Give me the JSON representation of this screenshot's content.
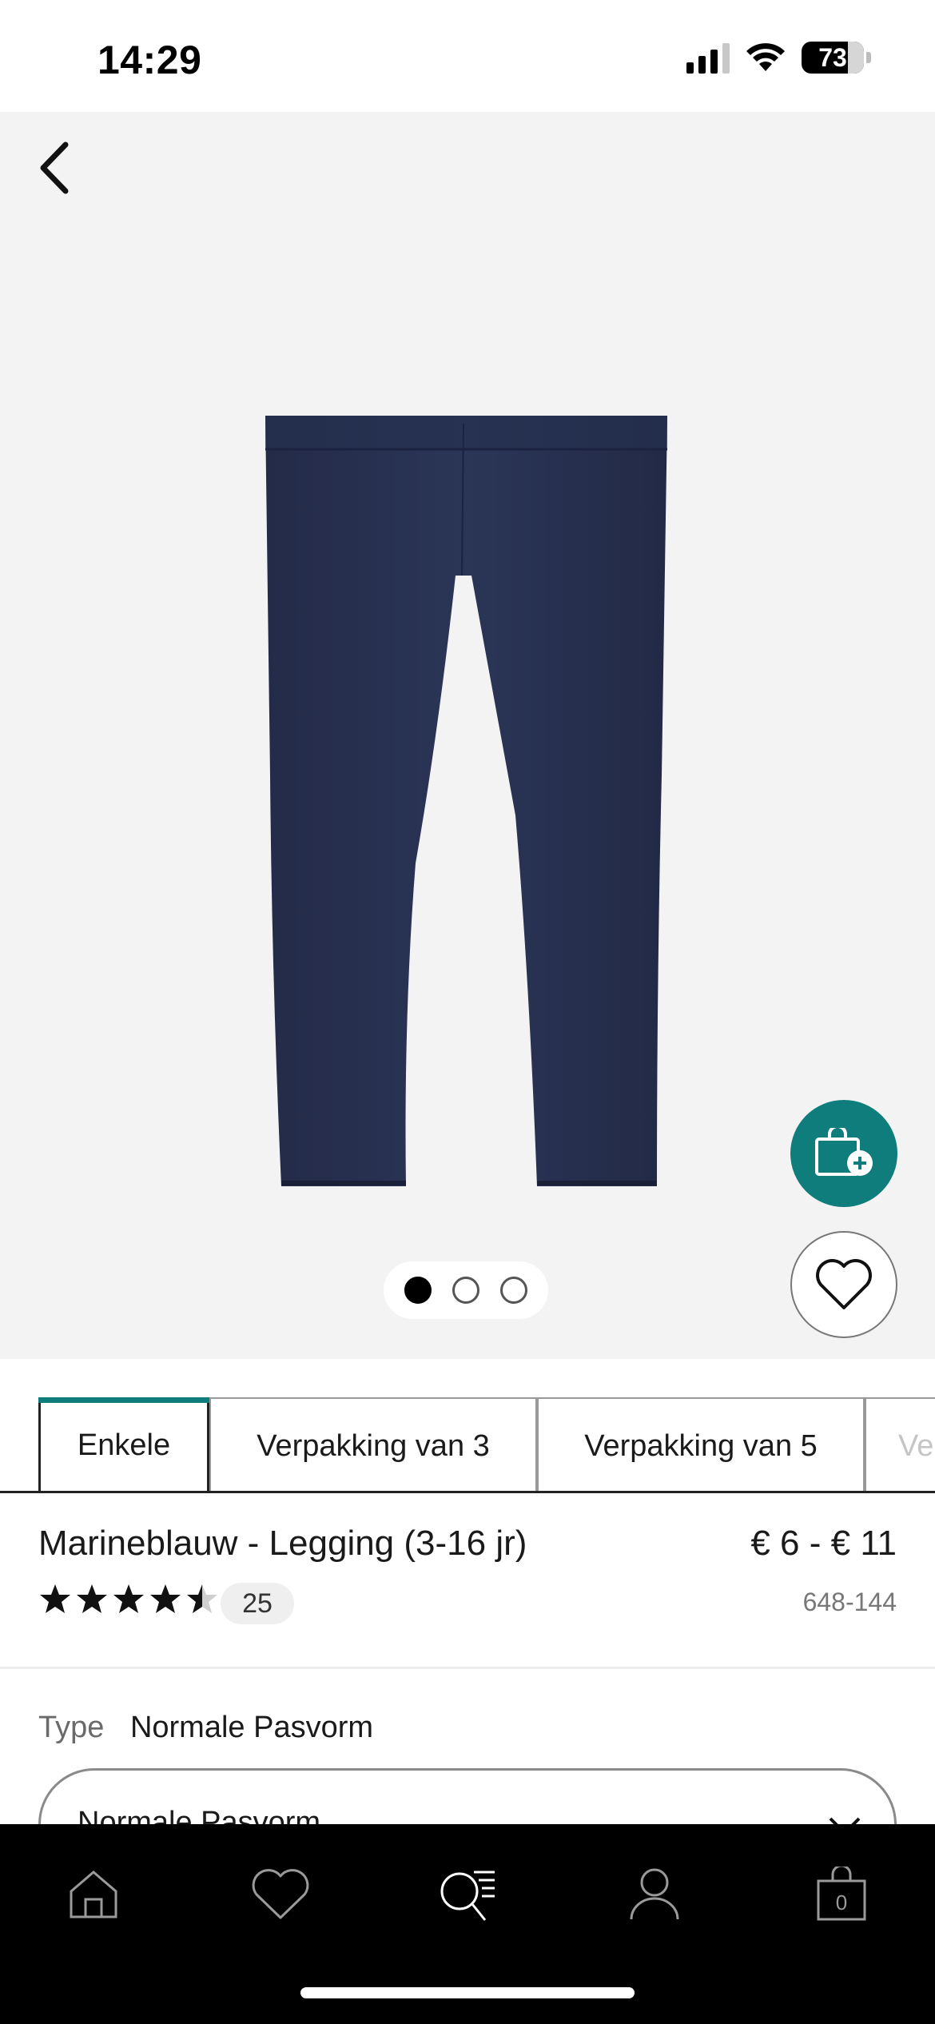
{
  "status_bar": {
    "time": "14:29",
    "battery": "73",
    "icons": [
      "signal-icon",
      "wifi-icon",
      "battery-icon"
    ]
  },
  "product": {
    "title": "Marineblauw - Legging (3-16 jr)",
    "price": "€ 6 - € 11",
    "sku": "648-144",
    "rating": 4.5,
    "rating_max": 5,
    "review_count": "25",
    "image_count": 3,
    "active_image": 1,
    "image_color": "#27304f"
  },
  "tabs": [
    {
      "label": "Enkele",
      "active": true
    },
    {
      "label": "Verpakking van 3",
      "active": false
    },
    {
      "label": "Verpakking van 5",
      "active": false
    },
    {
      "label": "Ve",
      "active": false
    }
  ],
  "type_selector": {
    "label": "Type",
    "value": "Normale Pasvorm",
    "selected": "Normale Pasvorm"
  },
  "nav": {
    "items": [
      "home-icon",
      "heart-icon",
      "search-menu-icon",
      "account-icon",
      "bag-icon"
    ],
    "bag_count": "0"
  },
  "colors": {
    "accent": "#0f7d7c",
    "hero_background": "#f3f3f3",
    "nav_background": "#000000"
  }
}
